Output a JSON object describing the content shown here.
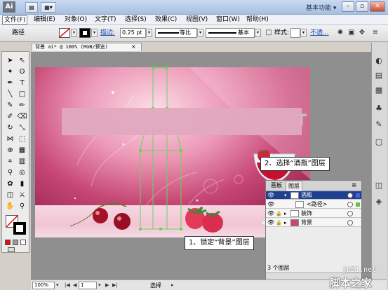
{
  "titlebar": {
    "app_logo": "Ai",
    "workspace": "基本功能",
    "workspace_arrow": "▾",
    "btn_minimize": "–",
    "btn_restore": "▫",
    "btn_close": "✕"
  },
  "menu": {
    "items": [
      "文件(F)",
      "编辑(E)",
      "对象(O)",
      "文字(T)",
      "选择(S)",
      "效果(C)",
      "视图(V)",
      "窗口(W)",
      "帮助(H)"
    ]
  },
  "control": {
    "selection_label": "路径",
    "stroke_label": "描边:",
    "stroke_value": "0.25 pt",
    "stroke_profile": "等比",
    "brush": "基本",
    "opacity_label": "不透...",
    "style_label": "样式:"
  },
  "document": {
    "tab_title": "背景 ai* @ 100% (RGB/预览)",
    "tab_close": "×"
  },
  "callouts": {
    "step1": "1、锁定“背景”图层",
    "step2": "2、选择“酒瓶”图层"
  },
  "layers_panel": {
    "tabs": [
      "画板",
      "图层"
    ],
    "active_tab": "图层",
    "layers": [
      {
        "name": "酒瓶",
        "expanded": true,
        "selected": true,
        "locked": false,
        "color": "#4a5ee8"
      },
      {
        "name": "<路径>",
        "sublayer": true,
        "selected": false,
        "locked": false,
        "color": "#6abf4b"
      },
      {
        "name": "装饰",
        "expanded": false,
        "selected": false,
        "locked": true,
        "color": "#4a5ee8"
      },
      {
        "name": "背景",
        "expanded": false,
        "selected": false,
        "locked": true,
        "color": "#e83a3a"
      }
    ],
    "count": "3 个图层"
  },
  "status": {
    "zoom": "100%",
    "page": "1",
    "tool": "选择"
  },
  "watermark": {
    "site": "jb51.net",
    "brand": "脚本之家"
  },
  "colors": {
    "selection_outline": "#6bd35a",
    "artboard_deep": "#a62f5c",
    "layer_selected_bg": "#1f3f8f"
  }
}
